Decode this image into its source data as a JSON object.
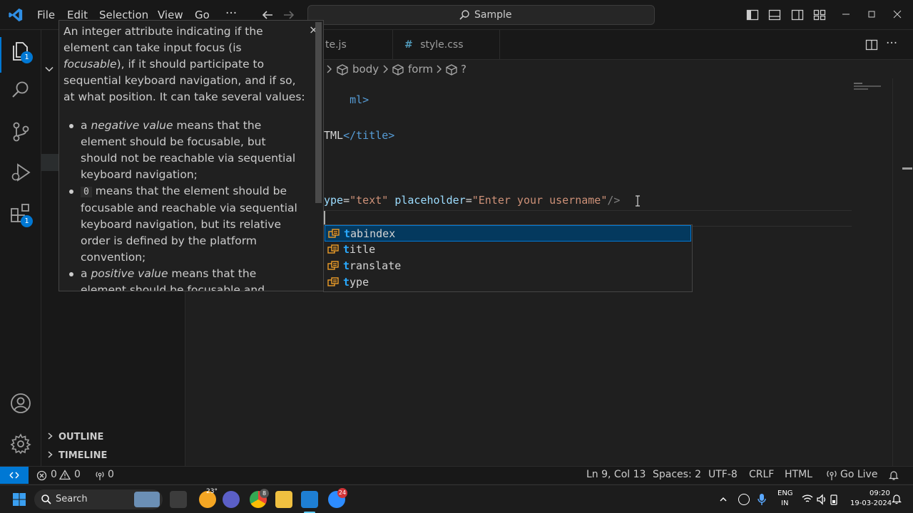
{
  "titlebar": {
    "menu": [
      "File",
      "Edit",
      "Selection",
      "View",
      "Go",
      "···"
    ],
    "search_label": "Sample"
  },
  "activity": {
    "explorer_badge": "1",
    "extensions_badge": "1"
  },
  "sidebar": {
    "outline": "OUTLINE",
    "timeline": "TIMELINE"
  },
  "tabs": [
    {
      "label": "te.js"
    },
    {
      "label": "style.css",
      "icon": "#"
    }
  ],
  "breadcrumb": {
    "items": [
      "body",
      "form",
      "?"
    ]
  },
  "code": {
    "line_html_close": "ml>",
    "title_line_text": "TML",
    "title_line_tag": "</title>",
    "input_attr1": "ype",
    "input_eq1": "=",
    "input_val1": "\"text\"",
    "input_attr2": "placeholder",
    "input_eq2": "=",
    "input_val2": "\"Enter your username\"",
    "input_close": "/>"
  },
  "suggestions": [
    {
      "match": "t",
      "rest": "abindex",
      "selected": true
    },
    {
      "match": "t",
      "rest": "itle",
      "selected": false
    },
    {
      "match": "t",
      "rest": "ranslate",
      "selected": false
    },
    {
      "match": "t",
      "rest": "ype",
      "selected": false
    }
  ],
  "hover": {
    "close": "×",
    "intro_a": "An integer attribute indicating if the element can take input focus (is ",
    "intro_em": "focusable",
    "intro_b": "), if it should participate to sequential keyboard navigation, and if so, at what position. It can take several values:",
    "b1_pre": "a ",
    "b1_em": "negative value",
    "b1_post": " means that the element should be focusable, but should not be reachable via sequential keyboard navigation;",
    "b2_code": "0",
    "b2_post": " means that the element should be focusable and reachable via sequential keyboard navigation, but its relative order is defined by the platform convention;",
    "b3_pre": "a ",
    "b3_em": "positive value",
    "b3_post": " means that the element should be focusable and reachable via"
  },
  "status": {
    "errors": "0",
    "warnings": "0",
    "ports": "0",
    "position": "Ln 9, Col 13",
    "spaces": "Spaces: 2",
    "encoding": "UTF-8",
    "eol": "CRLF",
    "language": "HTML",
    "golive": "Go Live"
  },
  "taskbar": {
    "search": "Search",
    "weather": "23°",
    "chrome_badge": "8",
    "zoom_badge": "24",
    "lang_1": "ENG",
    "lang_2": "IN",
    "time": "09:20",
    "date": "19-03-2024"
  },
  "colors": {
    "accent": "#0078d4",
    "selection": "#04395e",
    "match": "#2aaaff"
  }
}
